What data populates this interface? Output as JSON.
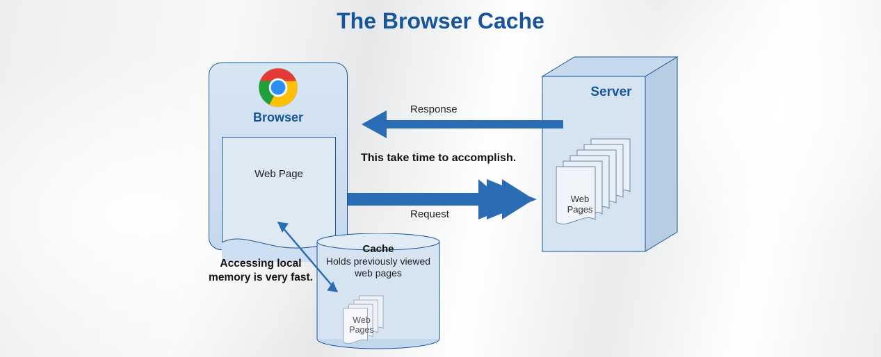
{
  "title": "The Browser Cache",
  "browser": {
    "label": "Browser",
    "icon_name": "chrome-icon",
    "webpage_label": "Web Page"
  },
  "server": {
    "label": "Server",
    "pages_label": "Web Pages"
  },
  "cache": {
    "title": "Cache",
    "subtitle": "Holds previously viewed web pages",
    "pages_label": "Web Pages"
  },
  "arrows": {
    "response_label": "Response",
    "request_label": "Request"
  },
  "annotations": {
    "middle": "This take time to accomplish.",
    "local": "Accessing local memory is very fast."
  },
  "colors": {
    "primary": "#16559b",
    "box_fill": "#d3e2f0"
  }
}
